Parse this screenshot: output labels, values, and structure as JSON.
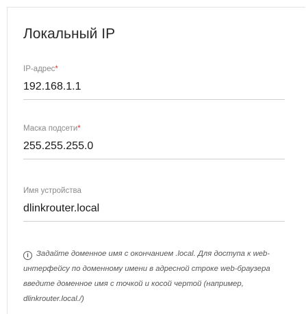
{
  "section": {
    "title": "Локальный IP"
  },
  "fields": {
    "ip": {
      "label": "IP-адрес",
      "required_mark": "*",
      "value": "192.168.1.1"
    },
    "mask": {
      "label": "Маска подсети",
      "required_mark": "*",
      "value": "255.255.255.0"
    },
    "hostname": {
      "label": "Имя устройства",
      "value": "dlinkrouter.local"
    }
  },
  "hint": {
    "icon": "info-icon",
    "text": "Задайте доменное имя с окончанием .local. Для доступа к web-интерфейсу по доменному имени в адресной строке web-браузера введите доменное имя с точкой и косой чертой (например, dlinkrouter.local./)"
  },
  "colors": {
    "required": "#e0322e",
    "label": "#8a8a8a",
    "underline": "#cfcfcf"
  }
}
